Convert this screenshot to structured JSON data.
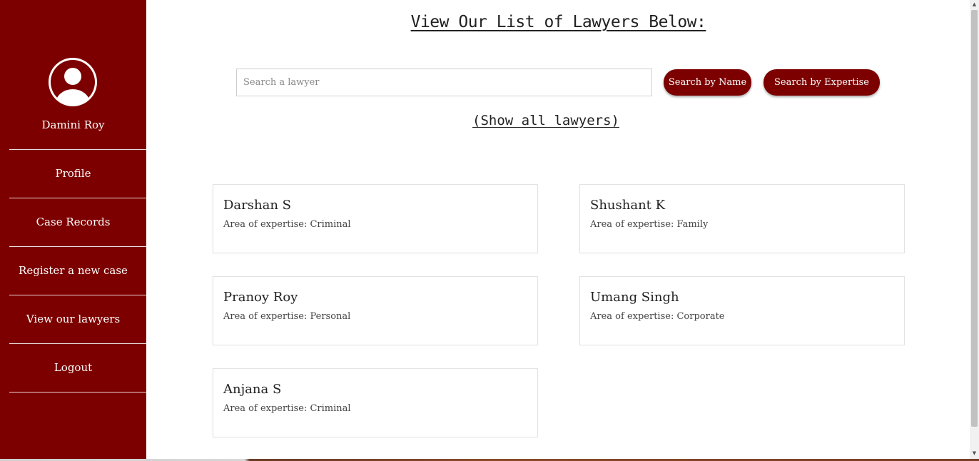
{
  "sidebar": {
    "user_name": "Damini Roy",
    "avatar_icon": "user-circle-icon",
    "items": [
      {
        "label": "Profile"
      },
      {
        "label": "Case Records"
      },
      {
        "label": "Register a new case"
      },
      {
        "label": "View our lawyers"
      },
      {
        "label": "Logout"
      }
    ]
  },
  "main": {
    "title": "View Our List of Lawyers Below:",
    "search": {
      "placeholder": "Search a lawyer",
      "value": ""
    },
    "buttons": {
      "search_by_name": "Search by Name",
      "search_by_expertise": "Search by Expertise"
    },
    "show_all": "(Show all lawyers)",
    "lawyers": [
      {
        "name": "Darshan S",
        "expertise": "Area of expertise: Criminal"
      },
      {
        "name": "Shushant K",
        "expertise": "Area of expertise: Family"
      },
      {
        "name": "Pranoy Roy",
        "expertise": "Area of expertise: Personal"
      },
      {
        "name": "Umang Singh",
        "expertise": "Area of expertise: Corporate"
      },
      {
        "name": "Anjana S",
        "expertise": "Area of expertise: Criminal"
      }
    ]
  },
  "colors": {
    "sidebar_bg": "#7d0000",
    "button_bg": "#7d0000",
    "text": "#222222"
  }
}
